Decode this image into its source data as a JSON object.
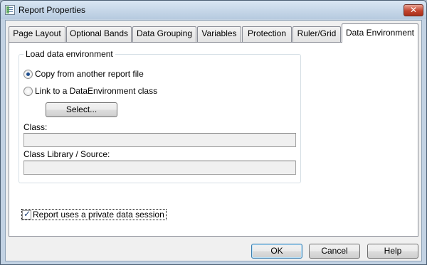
{
  "window": {
    "title": "Report Properties",
    "close_symbol": "✕"
  },
  "tabs": [
    {
      "label": "Page Layout"
    },
    {
      "label": "Optional Bands"
    },
    {
      "label": "Data Grouping"
    },
    {
      "label": "Variables"
    },
    {
      "label": "Protection"
    },
    {
      "label": "Ruler/Grid"
    },
    {
      "label": "Data Environment",
      "active": true
    }
  ],
  "data_environment": {
    "group_title": "Load data environment",
    "radio_copy": {
      "label": "Copy from another report file",
      "checked": true
    },
    "radio_link": {
      "label": "Link to a DataEnvironment class",
      "checked": false
    },
    "select_button": "Select...",
    "class_label": "Class:",
    "class_value": "",
    "class_library_label": "Class Library / Source:",
    "class_library_value": "",
    "private_session": {
      "label": "Report uses a private data session",
      "checked": true
    }
  },
  "buttons": {
    "ok": "OK",
    "cancel": "Cancel",
    "help": "Help"
  },
  "icons": {
    "app": "report-properties-icon",
    "close": "close-icon"
  },
  "colors": {
    "title_bar": "#c2d2e3",
    "close_button": "#c2432d",
    "default_button_border": "#3c7fb1"
  }
}
